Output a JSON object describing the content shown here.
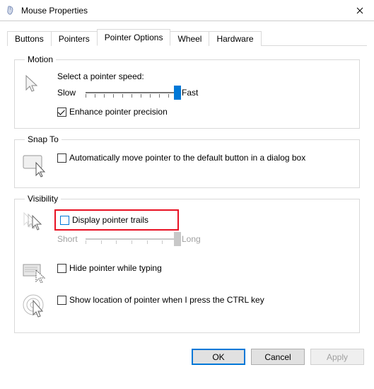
{
  "window": {
    "title": "Mouse Properties"
  },
  "tabs": [
    "Buttons",
    "Pointers",
    "Pointer Options",
    "Wheel",
    "Hardware"
  ],
  "active_tab_index": 2,
  "motion": {
    "legend": "Motion",
    "label": "Select a pointer speed:",
    "slow": "Slow",
    "fast": "Fast",
    "speed_value": 10,
    "speed_min": 0,
    "speed_max": 10,
    "enhance_label": "Enhance pointer precision",
    "enhance_checked": true
  },
  "snapto": {
    "legend": "Snap To",
    "auto_label": "Automatically move pointer to the default button in a dialog box",
    "auto_checked": false
  },
  "visibility": {
    "legend": "Visibility",
    "trails_label": "Display pointer trails",
    "trails_checked": false,
    "short": "Short",
    "long": "Long",
    "trails_value": 6,
    "trails_min": 0,
    "trails_max": 6,
    "hide_label": "Hide pointer while typing",
    "hide_checked": false,
    "ctrl_label": "Show location of pointer when I press the CTRL key",
    "ctrl_checked": false
  },
  "buttons": {
    "ok": "OK",
    "cancel": "Cancel",
    "apply": "Apply"
  }
}
